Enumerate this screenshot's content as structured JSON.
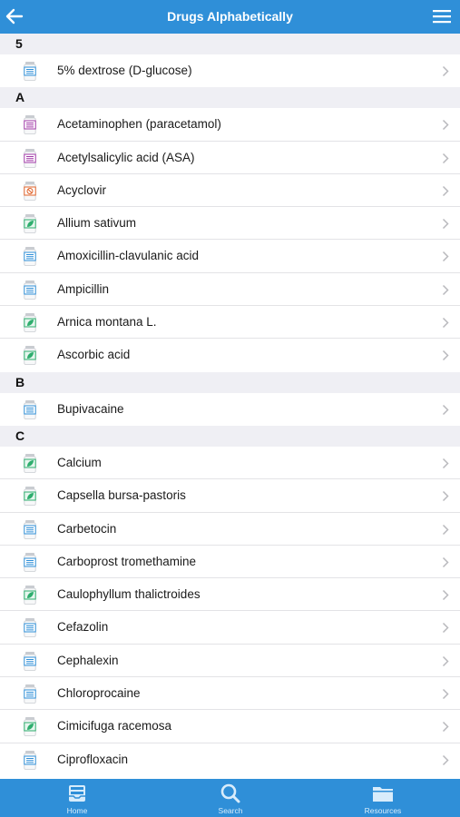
{
  "header": {
    "title": "Drugs Alphabetically"
  },
  "sections": [
    {
      "letter": "5",
      "items": [
        {
          "label": "5% dextrose (D-glucose)",
          "icon": "rx-bottle-icon"
        }
      ]
    },
    {
      "letter": "A",
      "items": [
        {
          "label": "Acetaminophen (paracetamol)",
          "icon": "otc-bottle-icon"
        },
        {
          "label": "Acetylsalicylic acid (ASA)",
          "icon": "otc-bottle-icon"
        },
        {
          "label": "Acyclovir",
          "icon": "caution-bottle-icon"
        },
        {
          "label": "Allium sativum",
          "icon": "herbal-bottle-icon"
        },
        {
          "label": "Amoxicillin-clavulanic acid",
          "icon": "rx-bottle-icon"
        },
        {
          "label": "Ampicillin",
          "icon": "rx-bottle-icon"
        },
        {
          "label": "Arnica montana L.",
          "icon": "herbal-bottle-icon"
        },
        {
          "label": "Ascorbic acid",
          "icon": "herbal-bottle-icon"
        }
      ]
    },
    {
      "letter": "B",
      "items": [
        {
          "label": "Bupivacaine",
          "icon": "rx-bottle-icon"
        }
      ]
    },
    {
      "letter": "C",
      "items": [
        {
          "label": "Calcium",
          "icon": "herbal-bottle-icon"
        },
        {
          "label": "Capsella bursa-pastoris",
          "icon": "herbal-bottle-icon"
        },
        {
          "label": "Carbetocin",
          "icon": "rx-bottle-icon"
        },
        {
          "label": "Carboprost tromethamine",
          "icon": "rx-bottle-icon"
        },
        {
          "label": "Caulophyllum thalictroides",
          "icon": "herbal-bottle-icon"
        },
        {
          "label": "Cefazolin",
          "icon": "rx-bottle-icon"
        },
        {
          "label": "Cephalexin",
          "icon": "rx-bottle-icon"
        },
        {
          "label": "Chloroprocaine",
          "icon": "rx-bottle-icon"
        },
        {
          "label": "Cimicifuga racemosa",
          "icon": "herbal-bottle-icon"
        },
        {
          "label": "Ciprofloxacin",
          "icon": "rx-bottle-icon"
        }
      ]
    }
  ],
  "tabbar": {
    "home_label": "Home",
    "search_label": "Search",
    "resources_label": "Resources"
  },
  "colors": {
    "accent": "#2f8fd8",
    "rx": "#2f8fd8",
    "otc": "#a23aa8",
    "caution": "#e0632a",
    "herbal": "#2fae6e"
  }
}
